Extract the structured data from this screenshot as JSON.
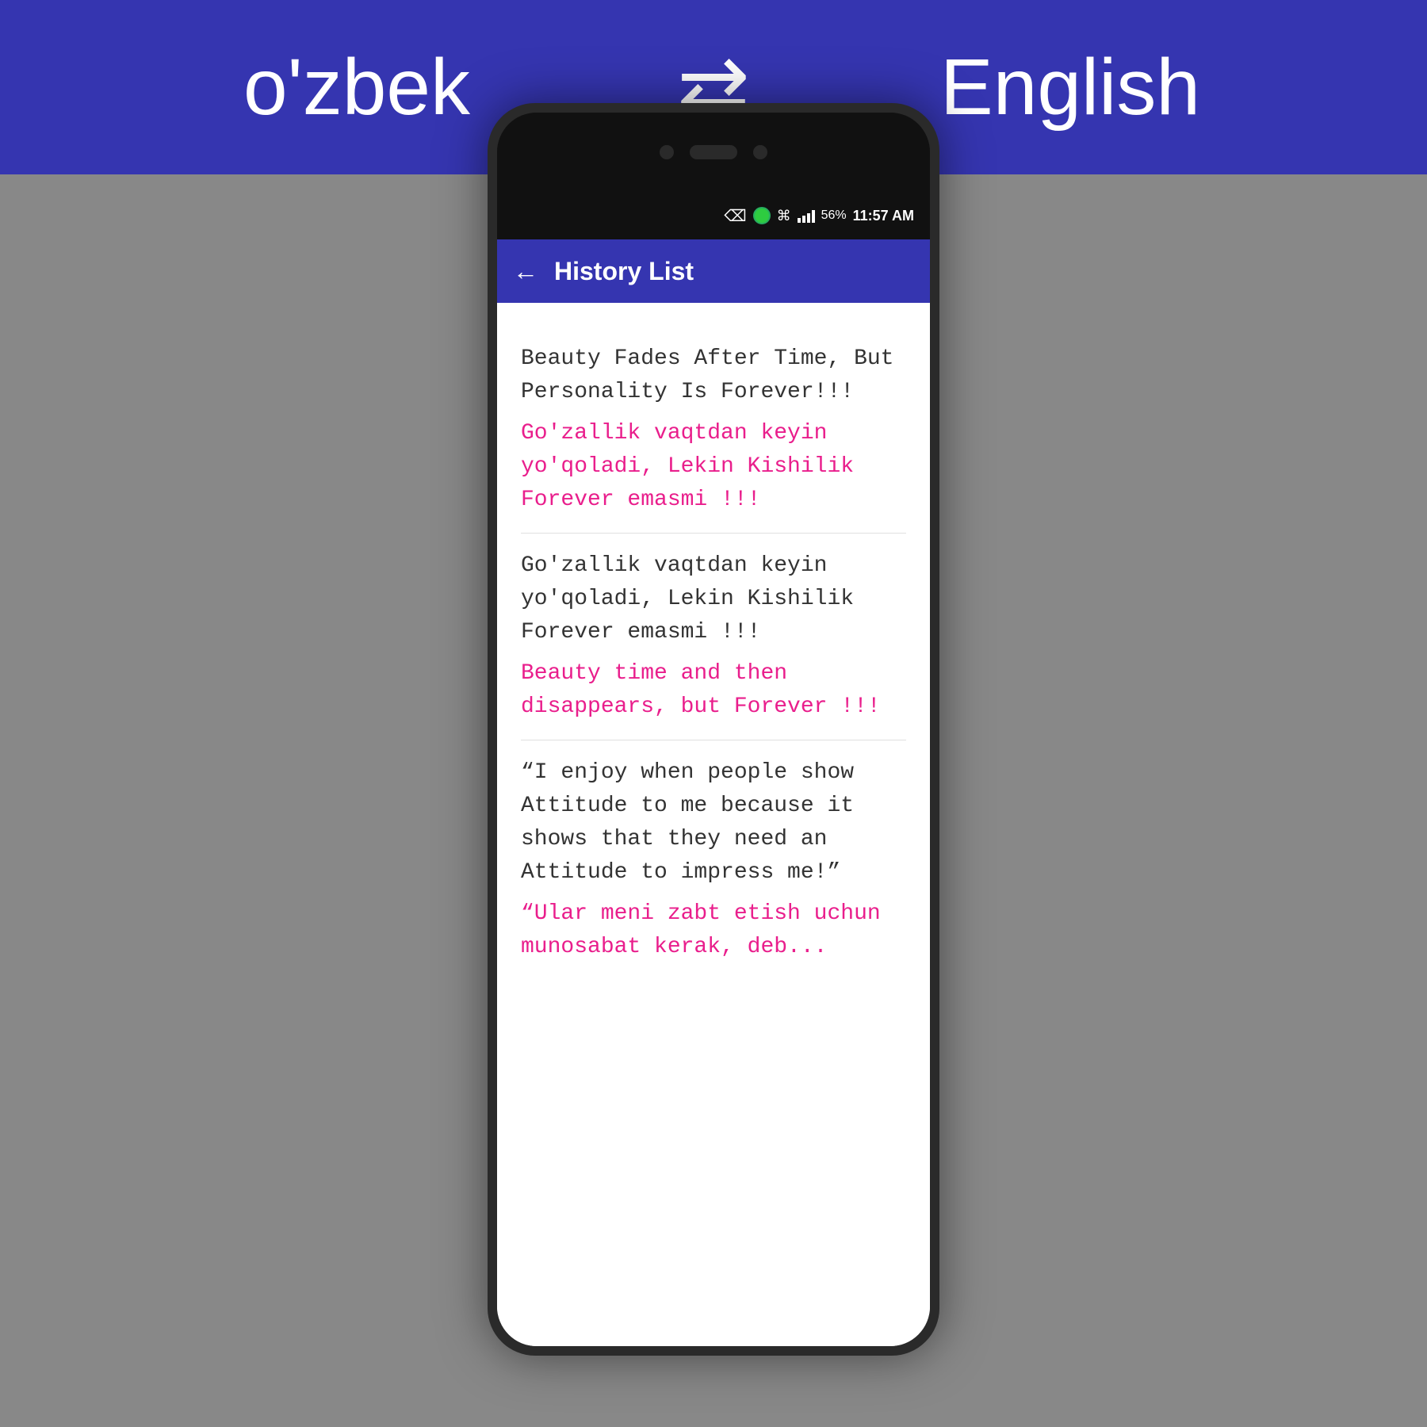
{
  "langBar": {
    "sourceLang": "o'zbek",
    "targetLang": "English",
    "swapSymbol": "⇄"
  },
  "statusBar": {
    "battery": "56%",
    "time": "11:57 AM"
  },
  "appHeader": {
    "title": "History List",
    "backLabel": "←"
  },
  "historyItems": [
    {
      "sourceText": "Beauty Fades After Time, But Personality Is Forever!!!",
      "translatedText": "Go'zallik vaqtdan keyin yo'qoladi, Lekin Kishilik Forever emasmi !!!"
    },
    {
      "sourceText": "Go'zallik vaqtdan keyin yo'qoladi, Lekin Kishilik Forever emasmi !!!",
      "translatedText": "Beauty time and then disappears, but Forever !!!"
    },
    {
      "sourceText": "“I enjoy when people show Attitude to me because it shows that they need an Attitude to impress me!”",
      "translatedText": "“Ular meni zabt etish uchun munosabat kerak, deb..."
    }
  ]
}
